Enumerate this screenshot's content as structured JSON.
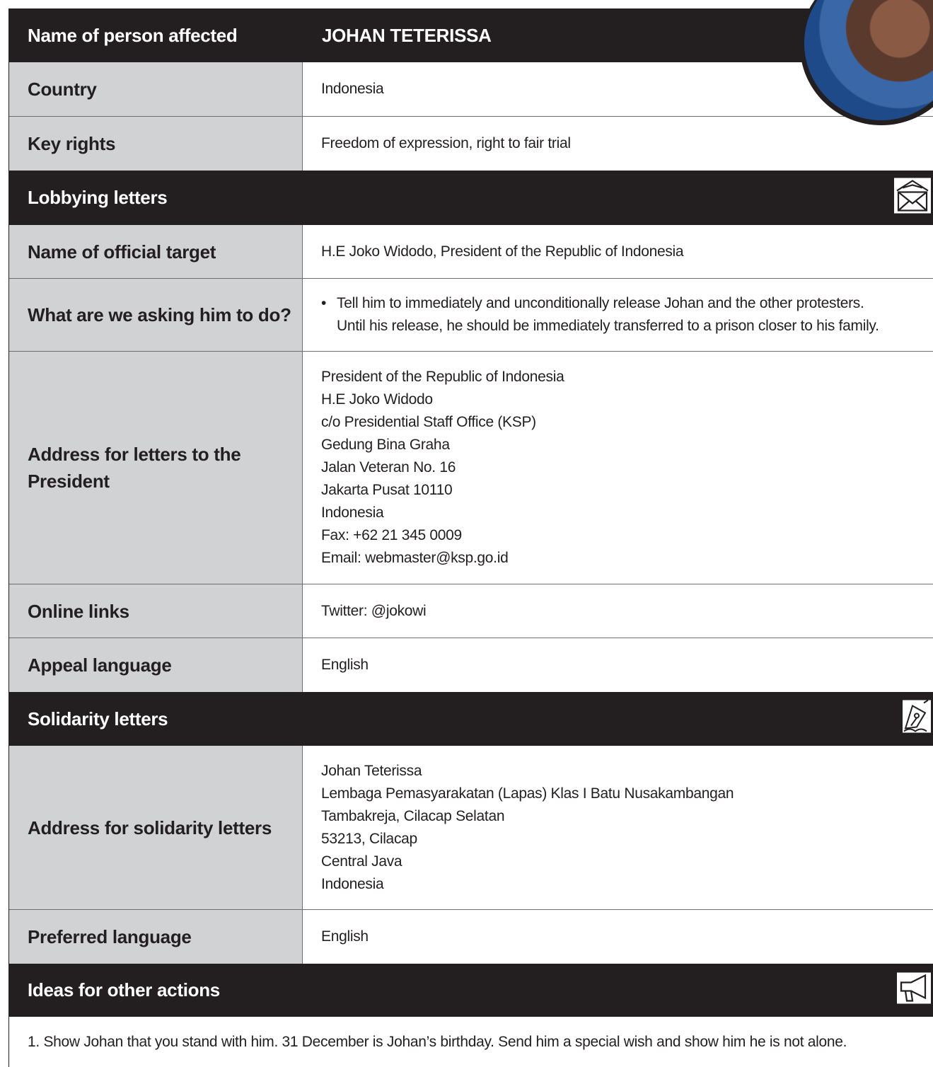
{
  "header": {
    "label": "Name of person affected",
    "name": "JOHAN TETERISSA"
  },
  "country": {
    "label": "Country",
    "value": "Indonesia"
  },
  "key_rights": {
    "label": "Key rights",
    "value": "Freedom of expression, right to fair trial"
  },
  "lobbying": {
    "title": "Lobbying letters",
    "icon": "envelope-icon",
    "official_target": {
      "label": "Name of official target",
      "value": "H.E Joko Widodo, President of the Republic of Indonesia"
    },
    "ask": {
      "label": "What are we asking him to do?",
      "bullet": "•",
      "line1": "Tell him to immediately and unconditionally release Johan and the other protesters.",
      "line2": "Until his release, he should be immediately transferred to a prison closer to his family."
    },
    "address": {
      "label": "Address for letters to the President",
      "lines": [
        "President of the Republic of Indonesia",
        "H.E Joko Widodo",
        "c/o Presidential Staff Office (KSP)",
        "Gedung Bina Graha",
        "Jalan Veteran No. 16",
        "Jakarta Pusat 10110",
        "Indonesia",
        "Fax: +62 21 345 0009",
        "Email: webmaster@ksp.go.id"
      ]
    },
    "online_links": {
      "label": "Online links",
      "value": "Twitter: @jokowi"
    },
    "appeal_language": {
      "label": "Appeal language",
      "value": "English"
    }
  },
  "solidarity": {
    "title": "Solidarity letters",
    "icon": "pen-nib-icon",
    "address": {
      "label": "Address for solidarity letters",
      "lines": [
        "Johan Teterissa",
        "Lembaga Pemasyarakatan (Lapas) Klas I Batu Nusakambangan",
        "Tambakreja, Cilacap Selatan",
        "53213, Cilacap",
        "Central Java",
        "Indonesia"
      ]
    },
    "preferred_language": {
      "label": "Preferred language",
      "value": "English"
    }
  },
  "other_actions": {
    "title": "Ideas for other actions",
    "icon": "megaphone-icon",
    "item1": "1. Show Johan that you stand with him. 31 December is Johan’s birthday. Send him a special wish and show him he is not alone."
  },
  "colors": {
    "dark": "#231f20",
    "label_bg": "#d1d2d4",
    "rule": "#6d6e71"
  }
}
